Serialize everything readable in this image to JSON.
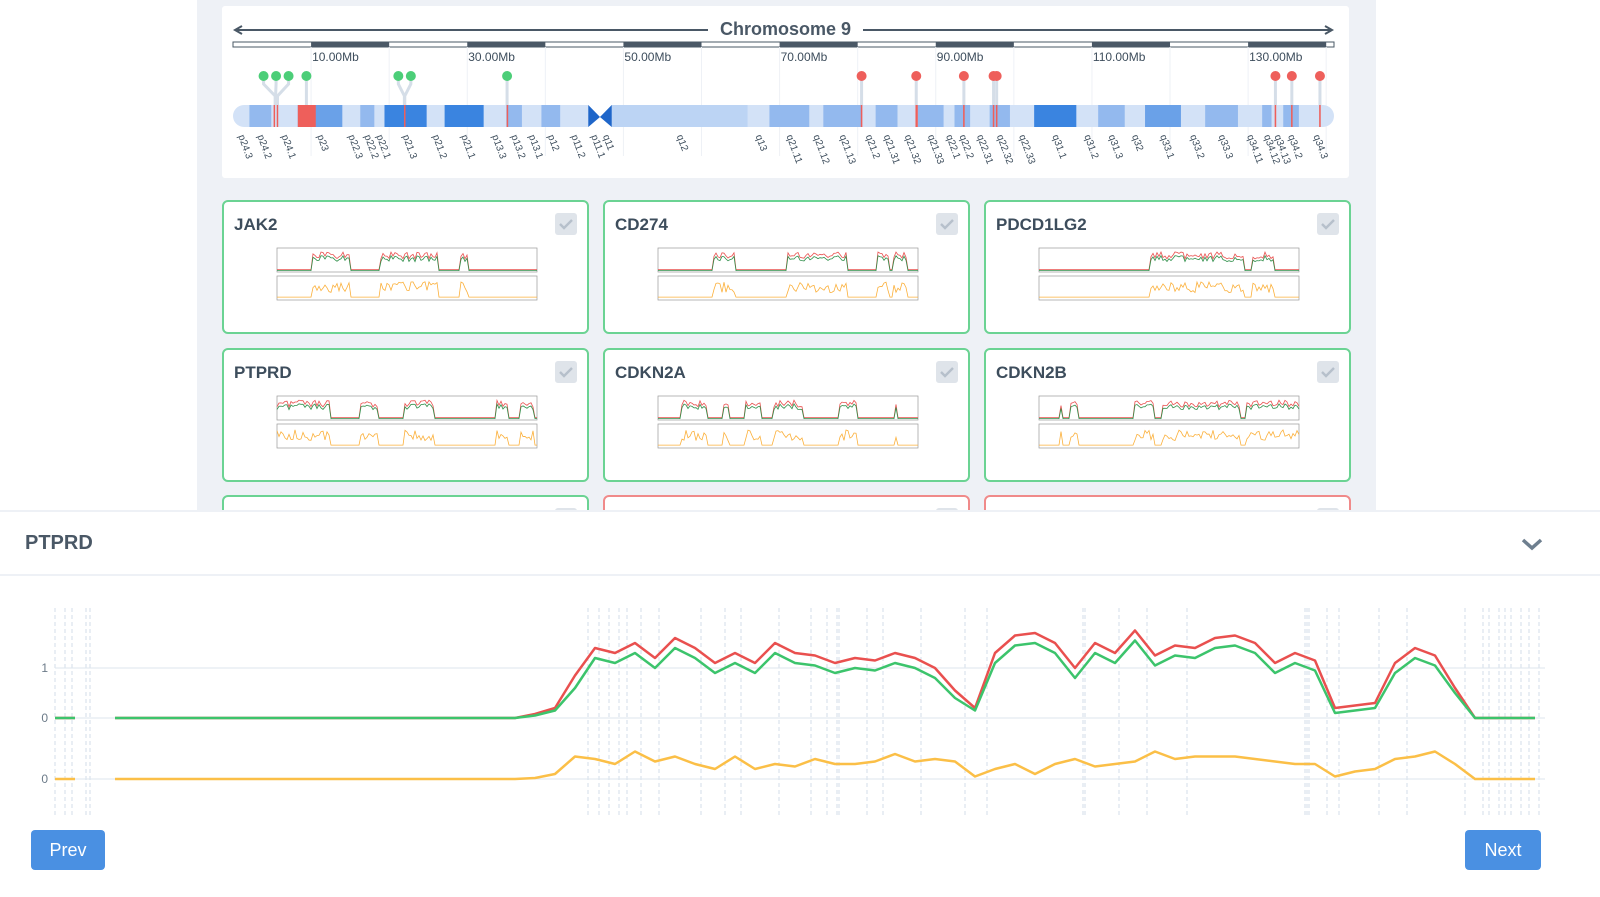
{
  "chromosome": {
    "title": "Chromosome 9",
    "length_mb": 141,
    "ruler_labels": [
      {
        "mb": 10,
        "label": "10.00Mb"
      },
      {
        "mb": 30,
        "label": "30.00Mb"
      },
      {
        "mb": 50,
        "label": "50.00Mb"
      },
      {
        "mb": 70,
        "label": "70.00Mb"
      },
      {
        "mb": 90,
        "label": "90.00Mb"
      },
      {
        "mb": 110,
        "label": "110.00Mb"
      },
      {
        "mb": 130,
        "label": "130.00Mb"
      }
    ],
    "stain_colors": {
      "gneg": "#d3e2f7",
      "gpos25": "#93b9ee",
      "gpos50": "#6aa1e8",
      "gpos75": "#3a84e0",
      "gvar": "#bcd4f4",
      "acen": "#1f66c9"
    },
    "bands": [
      {
        "name": "p24.3",
        "start": 0,
        "end": 2.1,
        "stain": "gneg"
      },
      {
        "name": "p24.2",
        "start": 2.1,
        "end": 4.9,
        "stain": "gpos25"
      },
      {
        "name": "p24.1",
        "start": 4.9,
        "end": 8.3,
        "stain": "gneg"
      },
      {
        "name": "p23",
        "start": 8.3,
        "end": 14.0,
        "stain": "gpos50"
      },
      {
        "name": "p22.3",
        "start": 14.0,
        "end": 16.3,
        "stain": "gneg"
      },
      {
        "name": "p22.2",
        "start": 16.3,
        "end": 18.1,
        "stain": "gpos25"
      },
      {
        "name": "p22.1",
        "start": 18.1,
        "end": 19.4,
        "stain": "gneg"
      },
      {
        "name": "p21.3",
        "start": 19.4,
        "end": 24.8,
        "stain": "gpos75"
      },
      {
        "name": "p21.2",
        "start": 24.8,
        "end": 27.1,
        "stain": "gneg"
      },
      {
        "name": "p21.1",
        "start": 27.1,
        "end": 32.1,
        "stain": "gpos75"
      },
      {
        "name": "p13.3",
        "start": 32.1,
        "end": 35.0,
        "stain": "gneg"
      },
      {
        "name": "p13.2",
        "start": 35.0,
        "end": 37.0,
        "stain": "gpos25"
      },
      {
        "name": "p13.1",
        "start": 37.0,
        "end": 39.5,
        "stain": "gneg"
      },
      {
        "name": "p12",
        "start": 39.5,
        "end": 41.9,
        "stain": "gpos25"
      },
      {
        "name": "p11.2",
        "start": 41.9,
        "end": 45.5,
        "stain": "gneg"
      },
      {
        "name": "p11.1",
        "start": 45.5,
        "end": 47.0,
        "stain": "acen"
      },
      {
        "name": "q11",
        "start": 47.0,
        "end": 48.5,
        "stain": "acen"
      },
      {
        "name": "q12",
        "start": 48.5,
        "end": 65.9,
        "stain": "gvar"
      },
      {
        "name": "q13",
        "start": 65.9,
        "end": 68.7,
        "stain": "gneg"
      },
      {
        "name": "q21.11",
        "start": 68.7,
        "end": 73.8,
        "stain": "gpos25"
      },
      {
        "name": "q21.12",
        "start": 73.8,
        "end": 75.6,
        "stain": "gneg"
      },
      {
        "name": "q21.13",
        "start": 75.6,
        "end": 80.5,
        "stain": "gpos25"
      },
      {
        "name": "q21.2",
        "start": 80.5,
        "end": 82.3,
        "stain": "gneg"
      },
      {
        "name": "q21.31",
        "start": 82.3,
        "end": 85.1,
        "stain": "gpos25"
      },
      {
        "name": "q21.32",
        "start": 85.1,
        "end": 87.7,
        "stain": "gneg"
      },
      {
        "name": "q21.33",
        "start": 87.7,
        "end": 91.0,
        "stain": "gpos25"
      },
      {
        "name": "q22.1",
        "start": 91.0,
        "end": 92.4,
        "stain": "gneg"
      },
      {
        "name": "q22.2",
        "start": 92.4,
        "end": 94.4,
        "stain": "gpos25"
      },
      {
        "name": "q22.31",
        "start": 94.4,
        "end": 96.9,
        "stain": "gneg"
      },
      {
        "name": "q22.32",
        "start": 96.9,
        "end": 99.5,
        "stain": "gpos25"
      },
      {
        "name": "q22.33",
        "start": 99.5,
        "end": 102.6,
        "stain": "gneg"
      },
      {
        "name": "q31.1",
        "start": 102.6,
        "end": 108.0,
        "stain": "gpos75"
      },
      {
        "name": "q31.2",
        "start": 108.0,
        "end": 110.8,
        "stain": "gneg"
      },
      {
        "name": "q31.3",
        "start": 110.8,
        "end": 114.2,
        "stain": "gpos25"
      },
      {
        "name": "q32",
        "start": 114.2,
        "end": 116.8,
        "stain": "gneg"
      },
      {
        "name": "q33.1",
        "start": 116.8,
        "end": 121.4,
        "stain": "gpos50"
      },
      {
        "name": "q33.2",
        "start": 121.4,
        "end": 124.5,
        "stain": "gneg"
      },
      {
        "name": "q33.3",
        "start": 124.5,
        "end": 128.7,
        "stain": "gpos25"
      },
      {
        "name": "q34.11",
        "start": 128.7,
        "end": 131.8,
        "stain": "gneg"
      },
      {
        "name": "q34.12",
        "start": 131.8,
        "end": 133.0,
        "stain": "gpos25"
      },
      {
        "name": "q34.13",
        "start": 133.0,
        "end": 134.5,
        "stain": "gneg"
      },
      {
        "name": "q34.2",
        "start": 134.5,
        "end": 136.5,
        "stain": "gpos25"
      },
      {
        "name": "q34.3",
        "start": 136.5,
        "end": 141.0,
        "stain": "gneg"
      }
    ],
    "highlights": [
      {
        "start": 5.2,
        "end": 5.35
      },
      {
        "start": 5.6,
        "end": 5.75
      },
      {
        "start": 8.3,
        "end": 10.6
      },
      {
        "start": 21.9,
        "end": 22.05
      },
      {
        "start": 35.05,
        "end": 35.2
      },
      {
        "start": 80.4,
        "end": 80.6
      },
      {
        "start": 87.4,
        "end": 87.7
      },
      {
        "start": 93.5,
        "end": 93.7
      },
      {
        "start": 97.3,
        "end": 97.5
      },
      {
        "start": 97.7,
        "end": 97.9
      },
      {
        "start": 133.4,
        "end": 133.6
      },
      {
        "start": 135.5,
        "end": 135.7
      },
      {
        "start": 139.1,
        "end": 139.3
      }
    ],
    "markers": [
      {
        "pos_mb": 5.4,
        "status": "pass"
      },
      {
        "pos_mb": 5.45,
        "status": "pass"
      },
      {
        "pos_mb": 5.7,
        "status": "pass"
      },
      {
        "pos_mb": 9.4,
        "status": "pass"
      },
      {
        "pos_mb": 21.95,
        "status": "pass"
      },
      {
        "pos_mb": 22.0,
        "status": "pass"
      },
      {
        "pos_mb": 35.1,
        "status": "pass"
      },
      {
        "pos_mb": 80.5,
        "status": "fail"
      },
      {
        "pos_mb": 87.5,
        "status": "fail"
      },
      {
        "pos_mb": 93.6,
        "status": "fail"
      },
      {
        "pos_mb": 97.4,
        "status": "fail"
      },
      {
        "pos_mb": 97.8,
        "status": "fail"
      },
      {
        "pos_mb": 133.5,
        "status": "fail"
      },
      {
        "pos_mb": 135.6,
        "status": "fail"
      },
      {
        "pos_mb": 139.2,
        "status": "fail"
      }
    ],
    "status_colors": {
      "pass": "#4cce78",
      "fail": "#ee5f5b"
    }
  },
  "gene_cards": [
    {
      "name": "JAK2",
      "status": "pass"
    },
    {
      "name": "CD274",
      "status": "pass"
    },
    {
      "name": "PDCD1LG2",
      "status": "pass"
    },
    {
      "name": "PTPRD",
      "status": "pass"
    },
    {
      "name": "CDKN2A",
      "status": "pass"
    },
    {
      "name": "CDKN2B",
      "status": "pass"
    }
  ],
  "cutoff_cards": [
    {
      "status": "pass"
    },
    {
      "status": "fail"
    },
    {
      "status": "fail"
    }
  ],
  "detail": {
    "title": "PTPRD",
    "prev_label": "Prev",
    "next_label": "Next"
  },
  "chart_data": {
    "type": "line",
    "panels": [
      {
        "yticks": [
          {
            "value": 0,
            "label": "0"
          },
          {
            "value": 1,
            "label": "1"
          }
        ]
      },
      {
        "yticks": [
          {
            "value": 0,
            "label": "0"
          }
        ]
      }
    ],
    "colors": {
      "red": "#e9504f",
      "green": "#3cc46c",
      "orange": "#fbbf47"
    },
    "series": [
      {
        "color": "red",
        "panel": 0,
        "values": [
          0,
          0,
          null,
          0,
          0,
          0,
          0,
          0,
          0,
          0,
          0,
          0,
          0,
          0,
          0,
          0,
          0,
          0,
          0,
          0,
          0,
          0,
          0,
          0,
          0.08,
          0.2,
          0.85,
          1.4,
          1.3,
          1.5,
          1.2,
          1.6,
          1.4,
          1.1,
          1.3,
          1.1,
          1.5,
          1.3,
          1.25,
          1.1,
          1.2,
          1.15,
          1.3,
          1.2,
          1.0,
          0.55,
          0.2,
          1.3,
          1.65,
          1.7,
          1.5,
          1.0,
          1.5,
          1.3,
          1.75,
          1.25,
          1.45,
          1.4,
          1.6,
          1.65,
          1.5,
          1.1,
          1.3,
          1.15,
          0.2,
          0.25,
          0.3,
          1.1,
          1.4,
          1.25,
          0.6,
          0,
          0,
          0,
          0
        ]
      },
      {
        "color": "green",
        "panel": 0,
        "values": [
          0,
          0,
          null,
          0,
          0,
          0,
          0,
          0,
          0,
          0,
          0,
          0,
          0,
          0,
          0,
          0,
          0,
          0,
          0,
          0,
          0,
          0,
          0,
          0,
          0.05,
          0.15,
          0.6,
          1.2,
          1.1,
          1.3,
          1.0,
          1.4,
          1.2,
          0.9,
          1.1,
          0.9,
          1.3,
          1.1,
          1.05,
          0.9,
          1.0,
          0.95,
          1.1,
          1.0,
          0.8,
          0.4,
          0.15,
          1.1,
          1.45,
          1.5,
          1.3,
          0.8,
          1.3,
          1.1,
          1.55,
          1.05,
          1.25,
          1.2,
          1.4,
          1.45,
          1.3,
          0.9,
          1.1,
          0.95,
          0.1,
          0.15,
          0.2,
          0.9,
          1.2,
          1.05,
          0.5,
          0,
          0,
          0,
          0
        ]
      },
      {
        "color": "orange",
        "panel": 1,
        "values": [
          0,
          0,
          null,
          0,
          0,
          0,
          0,
          0,
          0,
          0,
          0,
          0,
          0,
          0,
          0,
          0,
          0,
          0,
          0,
          0,
          0,
          0,
          0,
          0,
          0.02,
          0.1,
          0.45,
          0.4,
          0.3,
          0.55,
          0.35,
          0.45,
          0.3,
          0.2,
          0.45,
          0.2,
          0.3,
          0.25,
          0.4,
          0.3,
          0.3,
          0.35,
          0.5,
          0.35,
          0.4,
          0.35,
          0.05,
          0.2,
          0.3,
          0.1,
          0.3,
          0.4,
          0.25,
          0.3,
          0.35,
          0.55,
          0.4,
          0.45,
          0.45,
          0.45,
          0.4,
          0.35,
          0.3,
          0.3,
          0.05,
          0.15,
          0.2,
          0.4,
          0.45,
          0.55,
          0.3,
          0,
          0,
          0,
          0
        ]
      }
    ],
    "region_lines": [
      0,
      0.5,
      0.85,
      1.55,
      1.75,
      26.65,
      27.2,
      27.7,
      28.2,
      28.6,
      29.3,
      30.2,
      32.3,
      33.5,
      34.3,
      36.2,
      37.8,
      38.6,
      39.1,
      39.2,
      40.6,
      41.4,
      43.3,
      45.5,
      46.6,
      51.4,
      51.5,
      53.2,
      54.6,
      56.6,
      62.5,
      62.6,
      62.7,
      63.6,
      64.2,
      66.2,
      67.6,
      70.5,
      71.4,
      71.7,
      72.2,
      72.5,
      72.8,
      73.3,
      73.7,
      74.2
    ]
  }
}
